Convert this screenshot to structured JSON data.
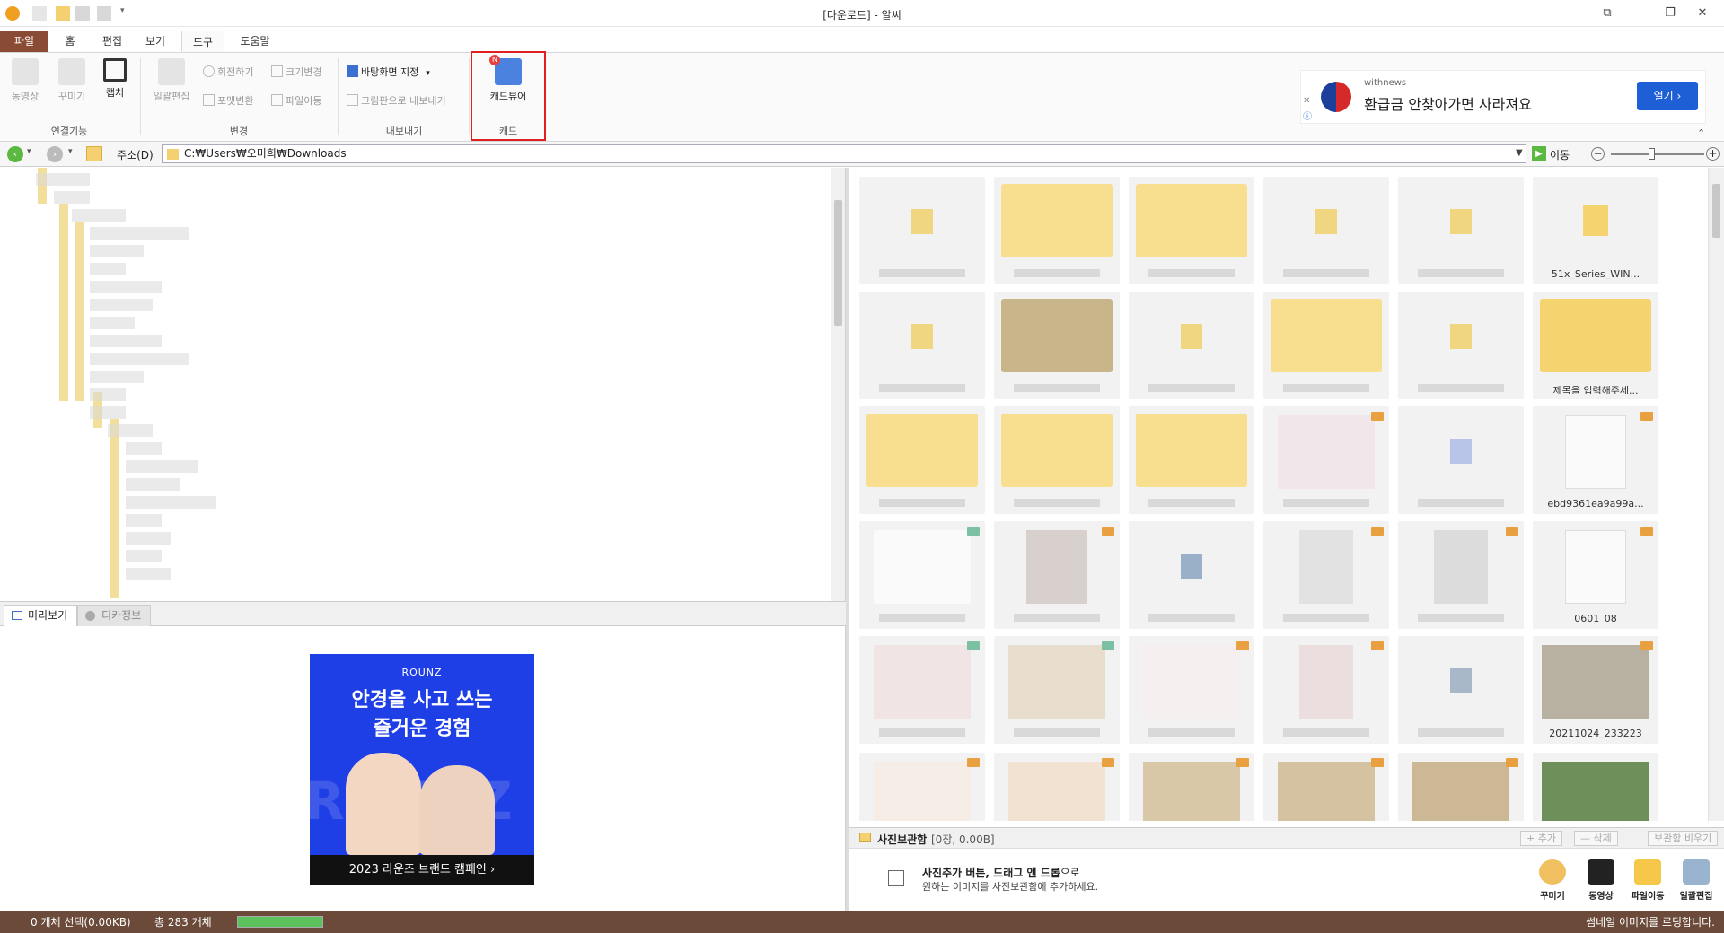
{
  "window": {
    "title": "[다운로드] - 알씨",
    "minimize": "—",
    "restore": "❐",
    "close": "✕",
    "extra": "⧉"
  },
  "ribbon_tabs": [
    {
      "label": "파일"
    },
    {
      "label": "홈"
    },
    {
      "label": "편집"
    },
    {
      "label": "보기"
    },
    {
      "label": "도구"
    },
    {
      "label": "도움말"
    }
  ],
  "ribbon": {
    "groups": {
      "link": "연결기능",
      "change": "변경",
      "export": "내보내기",
      "card": "캐드"
    },
    "buttons": {
      "video": "동영상",
      "decorate": "꾸미기",
      "capture": "캡처",
      "batch_edit": "일괄편집",
      "rotate": "회전하기",
      "resize": "크기변경",
      "format_convert": "포맷변환",
      "file_move": "파일이동",
      "set_wallpaper": "바탕화면 지정",
      "export_paint": "그림판으로 내보내기",
      "cad_viewer": "캐드뷰어"
    }
  },
  "ad_banner": {
    "source": "withnews",
    "text": "환급금 안찾아가면 사라져요",
    "button": "열기 ›"
  },
  "address": {
    "label": "주소(D)",
    "path": "C:₩Users₩오미희₩Downloads",
    "go_label": "이동"
  },
  "preview_tabs": [
    {
      "label": "미리보기"
    },
    {
      "label": "디카정보"
    }
  ],
  "preview_ad": {
    "brand": "ROUNZ",
    "headline_1": "안경을 사고 쓰는",
    "headline_2": "즐거운 경험",
    "watermark": "ROUNZ",
    "cta": "2023 라운즈 브랜드 캠페인  ›"
  },
  "thumbnail_captions": {
    "c1": "51x_Series_WIN...",
    "c2": "제목을 입력해주세...",
    "c3": "ebd9361ea9a99a...",
    "c4": "0601_08",
    "c5": "20211024_233223"
  },
  "photo_storage": {
    "title": "사진보관함",
    "count": "[0장, 0.00B]",
    "add": "+ 추가",
    "delete": "— 삭제",
    "clear": "보관함 비우기",
    "hint_bold": "사진추가 버튼, 드래그 앤 드롭",
    "hint_suffix": "으로",
    "hint_line2": "원하는 이미지를 사진보관함에 추가하세요.",
    "tools": [
      {
        "label": "꾸미기"
      },
      {
        "label": "동영상"
      },
      {
        "label": "파일이동"
      },
      {
        "label": "일괄편집"
      }
    ]
  },
  "status": {
    "selection": "0 개체 선택(0.00KB)",
    "total": "총 283 개체",
    "progress": 1.0,
    "message": "썸네일 이미지를 로딩합니다."
  }
}
